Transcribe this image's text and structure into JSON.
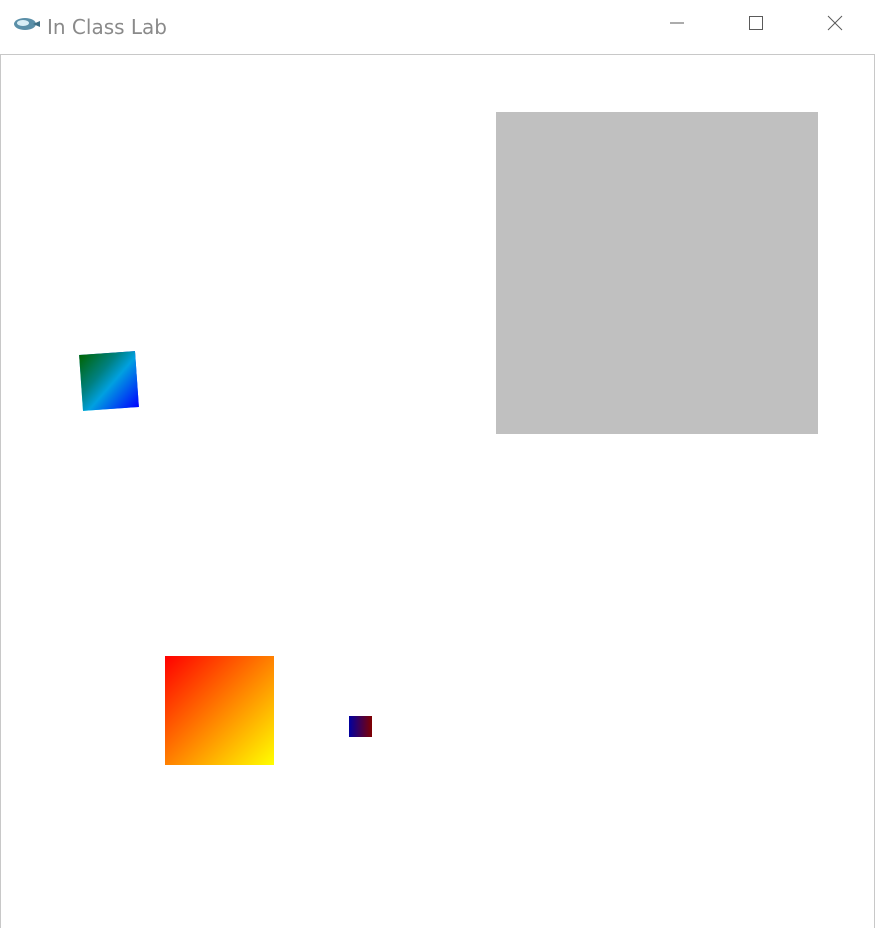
{
  "window": {
    "title": "In Class Lab",
    "app_icon": "app-logo-icon",
    "controls": [
      {
        "name": "minimize",
        "icon": "minimize-icon"
      },
      {
        "name": "maximize",
        "icon": "maximize-icon"
      },
      {
        "name": "close",
        "icon": "close-icon"
      }
    ]
  },
  "canvas": {
    "background": "#ffffff",
    "shapes": [
      {
        "name": "gray-square",
        "fill": "#c0c0c0"
      },
      {
        "name": "tilted-gradient-square",
        "gradient_colors": [
          "#006400",
          "#00ffff",
          "#0000ff"
        ]
      },
      {
        "name": "orange-gradient-square",
        "gradient_colors": [
          "#ff0000",
          "#ff8000",
          "#ffff00"
        ]
      },
      {
        "name": "small-gradient-square",
        "gradient_colors": [
          "#0000a0",
          "#800000"
        ]
      }
    ]
  }
}
